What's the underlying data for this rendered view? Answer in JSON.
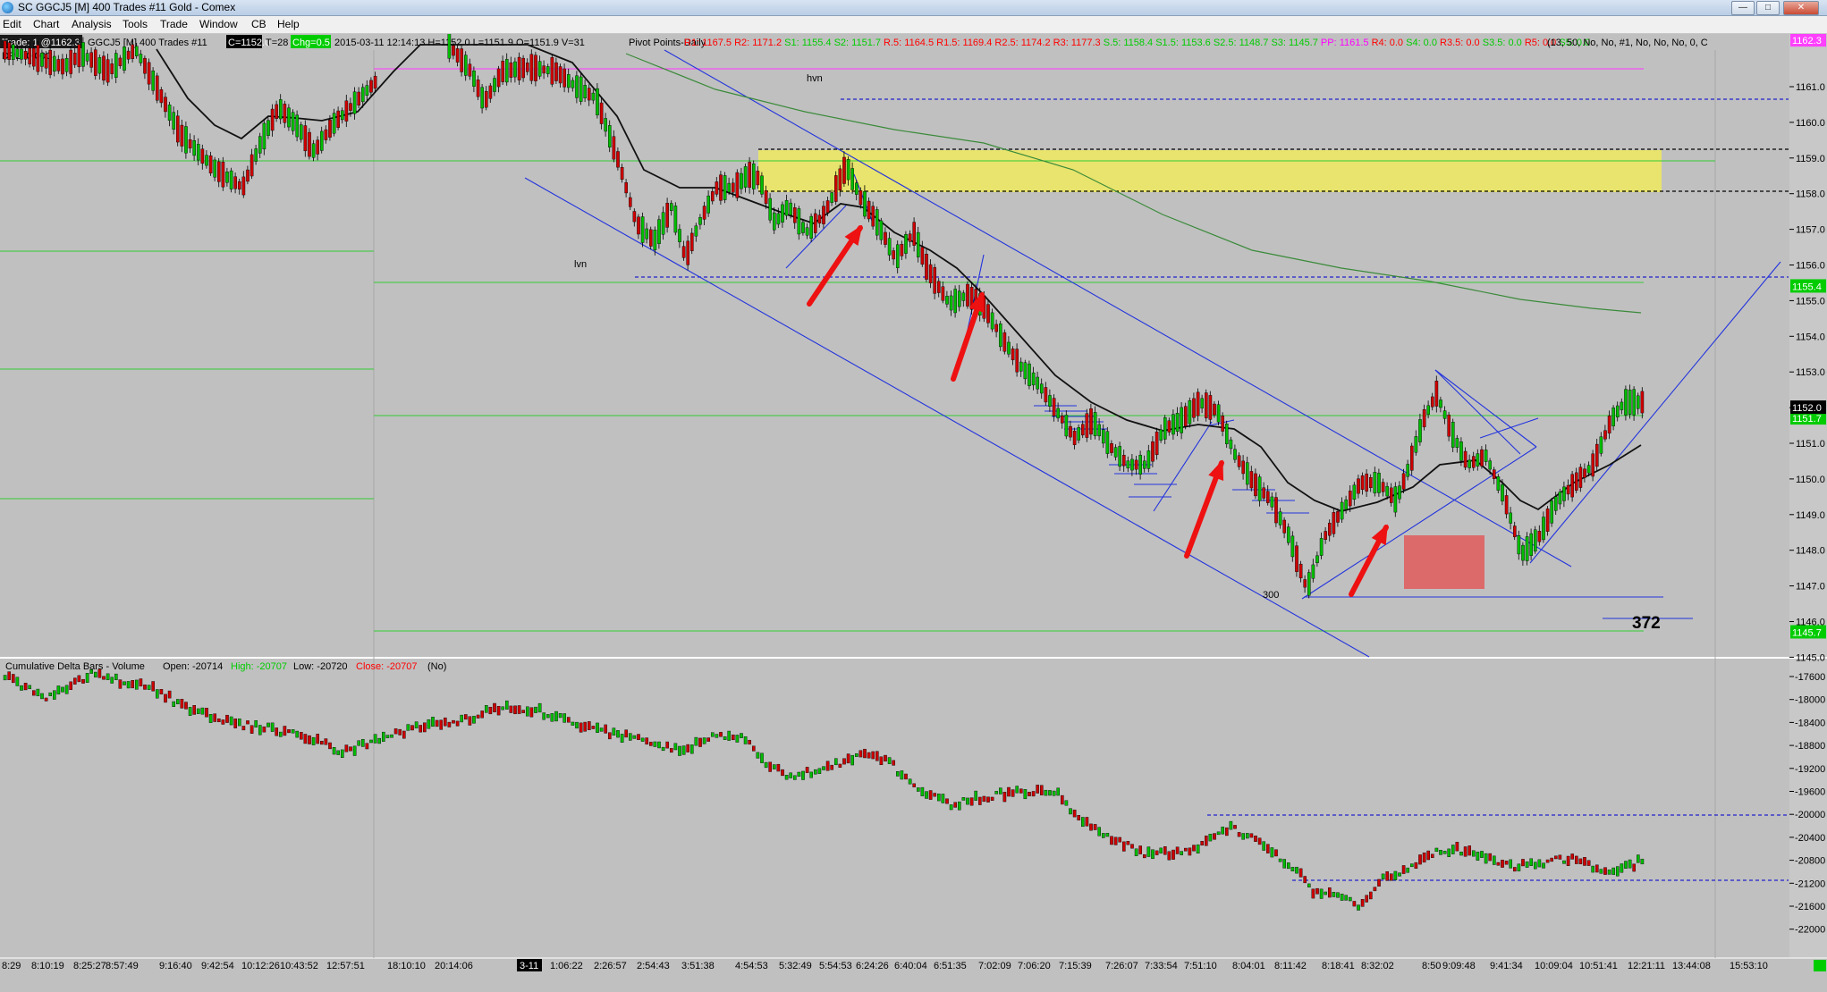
{
  "window": {
    "title": "SC GGCJ5 [M]  400 Trades  #11  Gold - Comex"
  },
  "menu": {
    "items": [
      "Edit",
      "Chart",
      "Analysis",
      "Tools",
      "Trade",
      "Window",
      "CB",
      "Help"
    ]
  },
  "chart_header": {
    "trade_box": "Trade: 1 @1162.3",
    "dpl": "DPL: 0.00C",
    "symbol_info": "GGCJ5 [M]  400 Trades  #11",
    "last_box": "C=1152.0",
    "t_count": "T=28",
    "chg_box": "Chg=0.5",
    "bar_info": "2015-03-11 12:14:13 H=1152.0 L=1151.9 O=1151.9 V=31",
    "study_name": "Pivot Points-Daily",
    "pivots": [
      {
        "text": "R1: 1167.5",
        "color": "#ff0000"
      },
      {
        "text": "R2: 1171.2",
        "color": "#ff0000"
      },
      {
        "text": "S1: 1155.4",
        "color": "#00cc00"
      },
      {
        "text": "S2: 1151.7",
        "color": "#00cc00"
      },
      {
        "text": "R.5: 1164.5",
        "color": "#ff0000"
      },
      {
        "text": "R1.5: 1169.4",
        "color": "#ff0000"
      },
      {
        "text": "R2.5: 1174.2",
        "color": "#ff0000"
      },
      {
        "text": "R3: 1177.3",
        "color": "#ff0000"
      },
      {
        "text": "S.5: 1158.4",
        "color": "#00cc00"
      },
      {
        "text": "S1.5: 1153.6",
        "color": "#00cc00"
      },
      {
        "text": "S2.5: 1148.7",
        "color": "#00cc00"
      },
      {
        "text": "S3: 1145.7",
        "color": "#00cc00"
      },
      {
        "text": "PP: 1161.5",
        "color": "#ff00ff"
      },
      {
        "text": "R4: 0.0",
        "color": "#ff0000"
      },
      {
        "text": "S4: 0.0",
        "color": "#00cc00"
      },
      {
        "text": "R3.5: 0.0",
        "color": "#ff0000"
      },
      {
        "text": "S3.5: 0.0",
        "color": "#00cc00"
      },
      {
        "text": "R5: 0.0",
        "color": "#ff0000"
      },
      {
        "text": "S5: 0.0",
        "color": "#00cc00"
      }
    ],
    "params": "(13, 50, No, No, #1, No, No, No, 0, C"
  },
  "annotations": {
    "hvn": "hvn",
    "lvn": "lvn",
    "low_label": "300",
    "big_number": "372"
  },
  "lower_header": {
    "study": "Cumulative Delta Bars - Volume",
    "open": "Open: -20714",
    "high": "High: -20707",
    "low": "Low: -20720",
    "close": "Close: -20707",
    "flag": "(No)"
  },
  "price_axis": {
    "labels": [
      "1161.0",
      "1160.0",
      "1159.0",
      "1158.0",
      "1157.0",
      "1156.0",
      "1155.0",
      "1154.0",
      "1153.0",
      "1152.0",
      "1151.0",
      "1150.0",
      "1149.0",
      "1148.0",
      "1147.0",
      "1146.0",
      "1145.0"
    ],
    "current_price": "1152.0",
    "tag_top": "1162.3",
    "tag_s1": "1155.4",
    "tag_s2": "1151.7",
    "tag_s3": "1145.7"
  },
  "delta_axis": {
    "labels": [
      "-17600",
      "-18000",
      "-18400",
      "-18800",
      "-19200",
      "-19600",
      "-20000",
      "-20400",
      "-20800",
      "-21200",
      "-21600",
      "-22000"
    ]
  },
  "time_axis": {
    "labels": [
      "8:29",
      "8:10:19",
      "8:25:27",
      "8:57:49",
      "9:16:40",
      "9:42:54",
      "10:12:26",
      "10:43:52",
      "12:57:51",
      "18:10:10",
      "20:14:06",
      "3-11",
      "1:06:22",
      "2:26:57",
      "2:54:43",
      "3:51:38",
      "4:54:53",
      "5:32:49",
      "5:54:53",
      "6:24:26",
      "6:40:04",
      "6:51:35",
      "7:02:09",
      "7:06:20",
      "7:15:39",
      "7:26:07",
      "7:33:54",
      "7:51:10",
      "8:04:01",
      "8:11:42",
      "8:18:41",
      "8:32:02",
      "8:50",
      "9:09:48",
      "9:41:34",
      "10:09:04",
      "10:51:41",
      "12:21:11",
      "13:44:08",
      "15:53:10"
    ],
    "date_marker": "3-11"
  },
  "colors": {
    "background": "#c0c0c0",
    "up_bar": "#00bb00",
    "down_bar": "#cc0000",
    "zone": "#f0f050",
    "box": "#e05050",
    "arrow": "#ee1111",
    "channel": "#2233dd",
    "ma": "#111111",
    "slow_ma": "#3a8a3a"
  }
}
